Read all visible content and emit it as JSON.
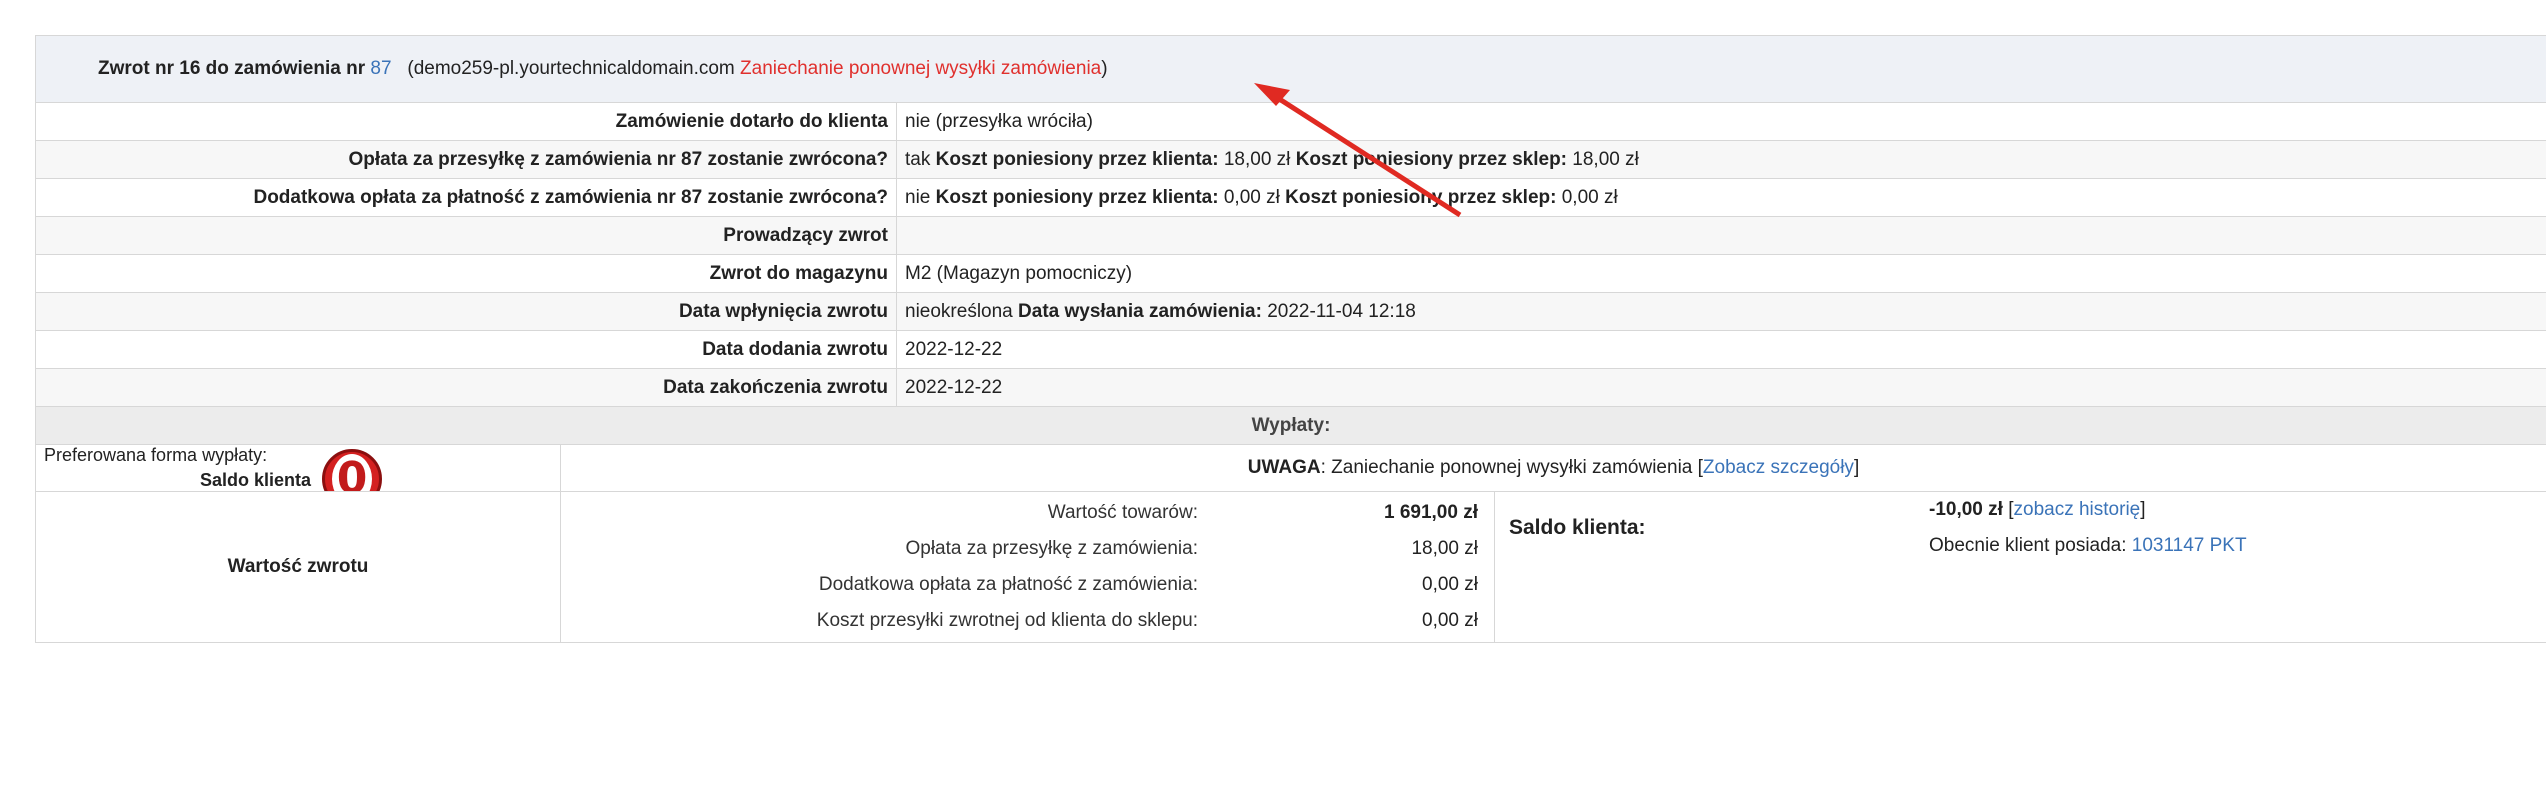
{
  "header": {
    "title_prefix": "Zwrot nr 16 do zamówienia nr",
    "order_number": "87",
    "domain": "(demo259-pl.yourtechnicaldomain.com",
    "status": "Zaniechanie ponownej wysyłki zamówienia",
    "close_paren": ")"
  },
  "rows": {
    "delivered": {
      "label": "Zamówienie dotarło do klienta",
      "value": "nie (przesyłka wróciła)"
    },
    "shipping_fee": {
      "label": "Opłata za przesyłkę z zamówienia nr 87 zostanie zwrócona?",
      "answer": "tak",
      "client_cost_label": "Koszt poniesiony przez klienta:",
      "client_cost": "18,00 zł",
      "shop_cost_label": "Koszt poniesiony przez sklep:",
      "shop_cost": "18,00 zł"
    },
    "payment_fee": {
      "label": "Dodatkowa opłata za płatność z zamówienia nr 87 zostanie zwrócona?",
      "answer": "nie",
      "client_cost_label": "Koszt poniesiony przez klienta:",
      "client_cost": "0,00 zł",
      "shop_cost_label": "Koszt poniesiony przez sklep:",
      "shop_cost": "0,00 zł"
    },
    "handler": {
      "label": "Prowadzący zwrot",
      "value": ""
    },
    "warehouse": {
      "label": "Zwrot do magazynu",
      "value": "M2 (Magazyn pomocniczy)"
    },
    "receipt_date": {
      "label": "Data wpłynięcia zwrotu",
      "value": "nieokreślona",
      "send_label": "Data wysłania zamówienia:",
      "send_value": "2022-11-04 12:18"
    },
    "added_date": {
      "label": "Data dodania zwrotu",
      "value": "2022-12-22"
    },
    "finished_date": {
      "label": "Data zakończenia zwrotu",
      "value": "2022-12-22"
    }
  },
  "payouts": {
    "section_title": "Wypłaty:",
    "preferred_label": "Preferowana forma wypłaty:",
    "preferred_value": "Saldo klienta",
    "badge_text": "0",
    "notice_bold": "UWAGA",
    "notice_text": ": Zaniechanie ponownej wysyłki zamówienia [",
    "notice_link": "Zobacz szczegóły",
    "notice_close": "]"
  },
  "return_value": {
    "label": "Wartość zwrotu",
    "items": [
      {
        "key": "Wartość towarów:",
        "value": "1 691,00 zł",
        "bold": true
      },
      {
        "key": "Opłata za przesyłkę z zamówienia:",
        "value": "18,00 zł",
        "bold": false
      },
      {
        "key": "Dodatkowa opłata za płatność z zamówienia:",
        "value": "0,00 zł",
        "bold": false
      },
      {
        "key": "Koszt przesyłki zwrotnej od klienta do sklepu:",
        "value": "0,00 zł",
        "bold": false
      }
    ],
    "saldo_label": "Saldo klienta:",
    "saldo_value": "-10,00 zł",
    "history_open": " [",
    "history_link": "zobacz historię",
    "history_close": "]",
    "points_label": "Obecnie klient posiada:",
    "points_value": "1031147 PKT"
  },
  "colors": {
    "link": "#3a73b8",
    "status_red": "#e0302d",
    "annotation_arrow": "#e02a22"
  }
}
